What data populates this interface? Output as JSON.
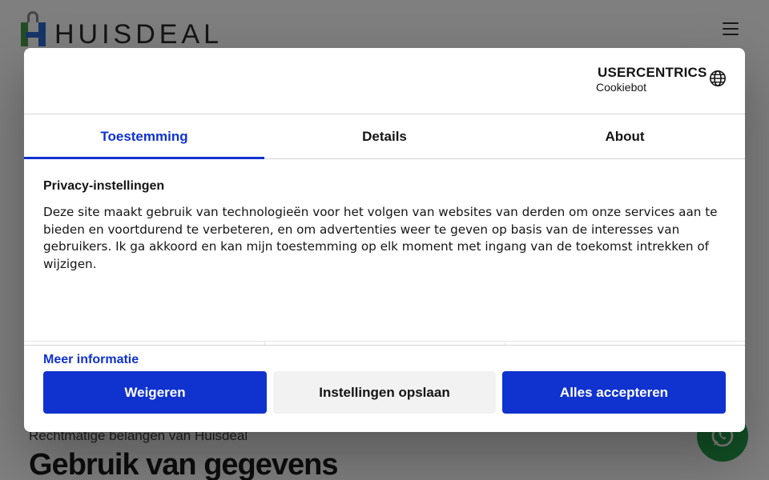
{
  "site": {
    "logo_text": "HUISDEAL",
    "subtitle": "Rechtmatige belangen van Huisdeal",
    "title": "Gebruik van gegevens"
  },
  "dialog": {
    "brand": {
      "line1": "USERCENTRICS",
      "line2": "Cookiebot"
    },
    "tabs": [
      {
        "label": "Toestemming",
        "active": true
      },
      {
        "label": "Details",
        "active": false
      },
      {
        "label": "About",
        "active": false
      }
    ],
    "heading": "Privacy-instellingen",
    "body": "Deze site maakt gebruik van technologieën voor het volgen van websites van derden om onze services aan te bieden en voortdurend te verbeteren, en om advertenties weer te geven op basis van de interesses van gebruikers. Ik ga akkoord en kan mijn toestemming op elk moment met ingang van de toekomst intrekken of wijzigen.",
    "more_info": "Meer informatie",
    "buttons": {
      "deny": "Weigeren",
      "save": "Instellingen opslaan",
      "accept": "Alles accepteren"
    }
  },
  "colors": {
    "accent": "#1032cf",
    "secondary_button": "#f2f2f2",
    "overlay": "rgba(0,0,0,0.5)",
    "whatsapp": "#25a04b"
  },
  "icons": [
    "menu-icon",
    "globe-icon",
    "usercentrics-shield-icon",
    "whatsapp-icon"
  ]
}
